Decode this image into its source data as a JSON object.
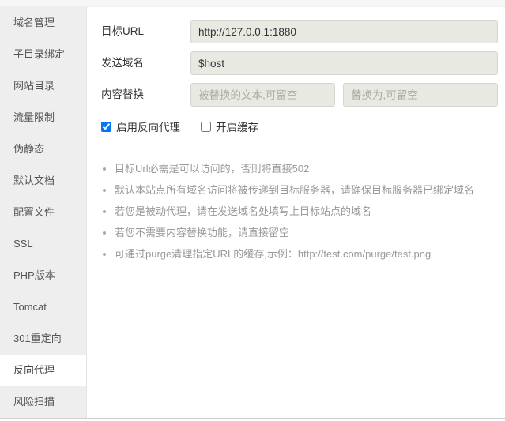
{
  "sidebar": {
    "items": [
      {
        "label": "域名管理",
        "active": false
      },
      {
        "label": "子目录绑定",
        "active": false
      },
      {
        "label": "网站目录",
        "active": false
      },
      {
        "label": "流量限制",
        "active": false
      },
      {
        "label": "伪静态",
        "active": false
      },
      {
        "label": "默认文档",
        "active": false
      },
      {
        "label": "配置文件",
        "active": false
      },
      {
        "label": "SSL",
        "active": false
      },
      {
        "label": "PHP版本",
        "active": false
      },
      {
        "label": "Tomcat",
        "active": false
      },
      {
        "label": "301重定向",
        "active": false
      },
      {
        "label": "反向代理",
        "active": true
      },
      {
        "label": "风险扫描",
        "active": false
      }
    ]
  },
  "form": {
    "target_url": {
      "label": "目标URL",
      "value": "http://127.0.0.1:1880",
      "placeholder": ""
    },
    "send_domain": {
      "label": "发送域名",
      "value": "$host",
      "placeholder": ""
    },
    "content_replace": {
      "label": "内容替换",
      "from_value": "",
      "from_placeholder": "被替换的文本,可留空",
      "to_value": "",
      "to_placeholder": "替换为,可留空"
    }
  },
  "checkboxes": [
    {
      "label": "启用反向代理",
      "checked": true
    },
    {
      "label": "开启缓存",
      "checked": false
    }
  ],
  "notes": [
    "目标Url必需是可以访问的，否则将直接502",
    "默认本站点所有域名访问将被传递到目标服务器，请确保目标服务器已绑定域名",
    "若您是被动代理，请在发送域名处填写上目标站点的域名",
    "若您不需要内容替换功能，请直接留空",
    "可通过purge清理指定URL的缓存,示例：http://test.com/purge/test.png"
  ],
  "colors": {
    "sidebar_bg": "#eeeeee",
    "active_bg": "#ffffff",
    "field_bg": "#e9e9e4",
    "field_border": "#d6d6d1",
    "note_text": "#999999",
    "label_text": "#333333"
  }
}
